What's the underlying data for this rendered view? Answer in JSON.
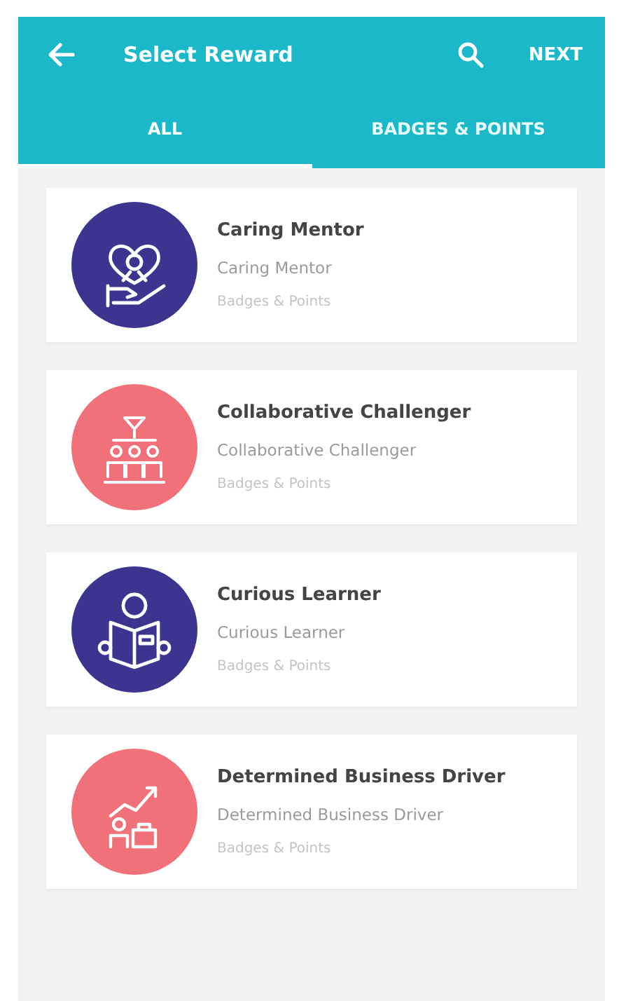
{
  "app_bar": {
    "title": "Select Reward",
    "action": "NEXT"
  },
  "tabs": [
    {
      "label": "ALL",
      "selected": true
    },
    {
      "label": "BADGES & POINTS",
      "selected": false
    }
  ],
  "rewards": [
    {
      "kind": "mentor",
      "color": "#3d3490",
      "title": "Caring Mentor",
      "subtitle": "Caring Mentor",
      "category": "Badges & Points"
    },
    {
      "kind": "team",
      "color": "#f0717a",
      "title": "Collaborative Challenger",
      "subtitle": "Collaborative Challenger",
      "category": "Badges & Points"
    },
    {
      "kind": "reader",
      "color": "#3d3490",
      "title": "Curious Learner",
      "subtitle": "Curious Learner",
      "category": "Badges & Points"
    },
    {
      "kind": "climber",
      "color": "#f0717a",
      "title": "Determined Business Driver",
      "subtitle": "Determined Business Driver",
      "category": "Badges & Points"
    }
  ]
}
